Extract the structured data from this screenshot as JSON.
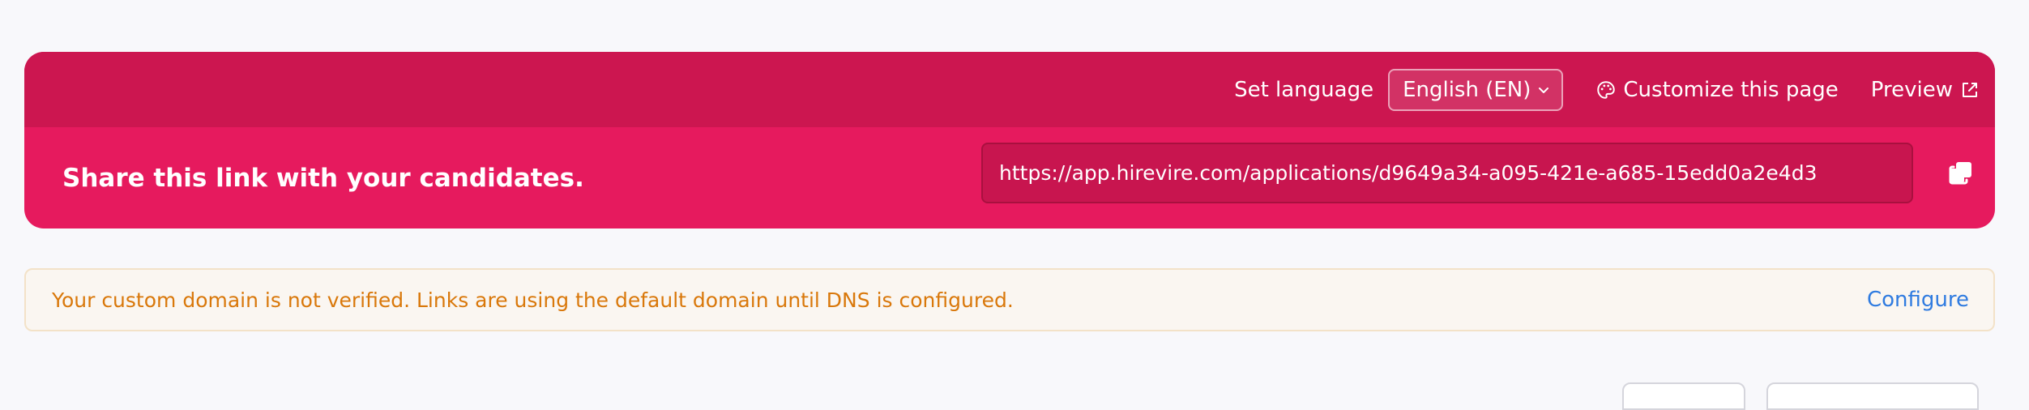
{
  "header": {
    "set_language_label": "Set language",
    "language_value": "English (EN)",
    "customize_label": "Customize this page",
    "preview_label": "Preview"
  },
  "share": {
    "title": "Share this link with your candidates.",
    "link_value": "https://app.hirevire.com/applications/d9649a34-a095-421e-a685-15edd0a2e4d3"
  },
  "alert": {
    "message": "Your custom domain is not verified. Links are using the default domain until DNS is configured.",
    "action_label": "Configure"
  },
  "colors": {
    "card_top": "#cc1650",
    "card_body": "#e61a5e",
    "alert_text": "#d9780b",
    "link": "#2f7be0"
  },
  "icons": {
    "language_chevron": "chevron-down-icon",
    "customize": "palette-icon",
    "preview": "external-link-icon",
    "copy": "copy-icon"
  }
}
